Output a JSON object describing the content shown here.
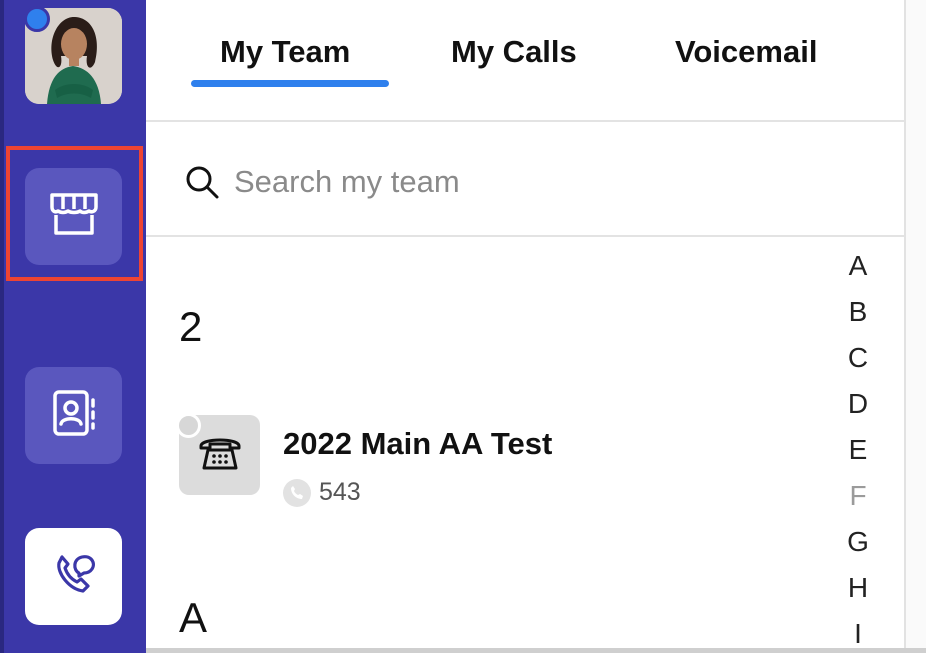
{
  "sidebar": {
    "avatar_alt": "User profile photo",
    "presence_color": "#2f80ed",
    "nav": [
      {
        "name": "storefront",
        "icon": "storefront-icon",
        "selected": true
      },
      {
        "name": "contacts",
        "icon": "contact-book-icon",
        "selected": false
      },
      {
        "name": "calls",
        "icon": "phone-chat-icon",
        "selected": false
      }
    ]
  },
  "tabs": [
    {
      "label": "My Team",
      "active": true
    },
    {
      "label": "My Calls",
      "active": false
    },
    {
      "label": "Voicemail",
      "active": false
    }
  ],
  "search": {
    "placeholder": "Search my team",
    "value": ""
  },
  "sections": [
    {
      "heading": "2",
      "contacts": [
        {
          "name": "2022 Main AA Test",
          "extension": "543",
          "icon": "desk-phone-icon"
        }
      ]
    },
    {
      "heading": "A",
      "contacts": []
    }
  ],
  "alphabet": [
    "A",
    "B",
    "C",
    "D",
    "E",
    "F",
    "G",
    "H",
    "I"
  ],
  "alphabet_dimmed": [
    "F"
  ],
  "colors": {
    "sidebar": "#3b37a8",
    "accent": "#2f80ed",
    "highlight": "#ee4433"
  }
}
